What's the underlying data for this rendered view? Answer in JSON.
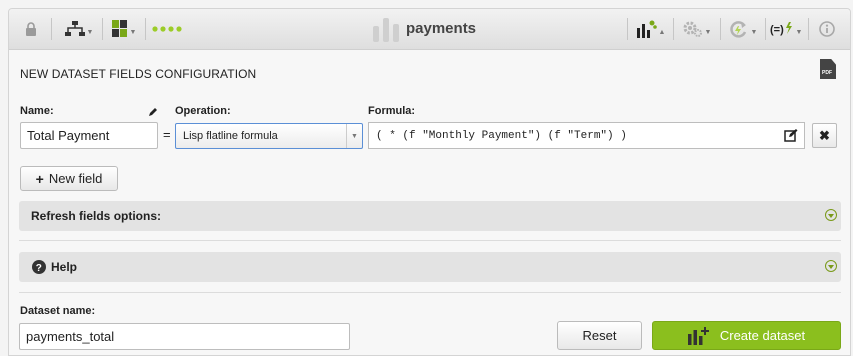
{
  "toolbar": {
    "title": "payments",
    "icons": [
      "lock-icon",
      "tree-icon",
      "numbers-icon",
      "dots-icon",
      "bars-logo-icon",
      "model-icon",
      "gear-icon",
      "refresh-icon",
      "formula-icon",
      "info-icon"
    ]
  },
  "section": {
    "title": "NEW DATASET FIELDS CONFIGURATION",
    "pdf_label": "PDF"
  },
  "fields": {
    "name_label": "Name:",
    "operation_label": "Operation:",
    "formula_label": "Formula:",
    "name_value": "Total Payment",
    "equals": "=",
    "operation_value": "Lisp flatline formula",
    "formula_value": "( * (f \"Monthly Payment\") (f \"Term\") )",
    "remove_label": "✖"
  },
  "new_field_button": {
    "plus": "+",
    "label": "New field"
  },
  "panels": {
    "refresh_label": "Refresh fields options:",
    "help_label": "Help"
  },
  "dataset": {
    "name_label": "Dataset name:",
    "name_value": "payments_total",
    "reset_label": "Reset",
    "create_label": "Create dataset"
  },
  "colors": {
    "accent": "#8bbf1e",
    "select_border": "#5b8fd6"
  }
}
